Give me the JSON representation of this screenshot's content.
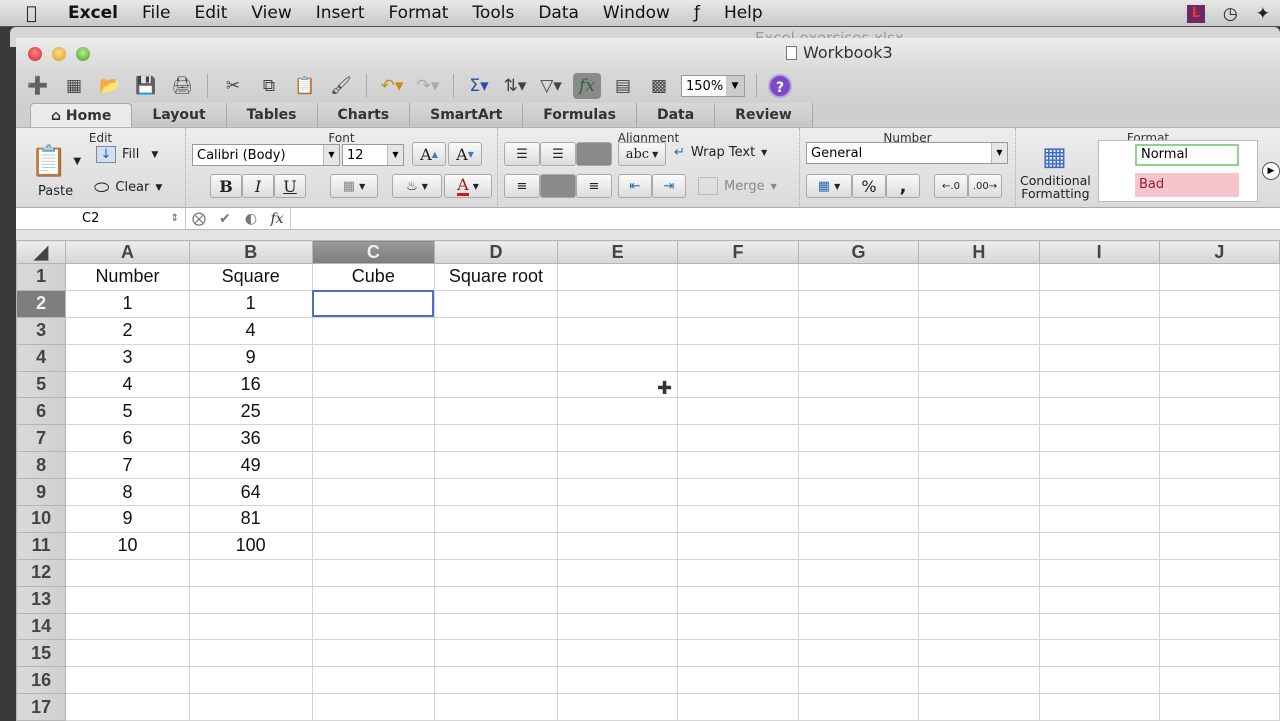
{
  "menubar": {
    "apple_icon": "apple-icon",
    "items": [
      "Excel",
      "File",
      "Edit",
      "View",
      "Insert",
      "Format",
      "Tools",
      "Data",
      "Window",
      "Help"
    ],
    "status_letter": "L"
  },
  "background_window": {
    "title": "Excel exercises.xlsx"
  },
  "window": {
    "title": "Workbook3"
  },
  "toolbar": {
    "zoom": "150%",
    "fx_label": "fx",
    "help_label": "?"
  },
  "tabs": [
    {
      "label": "Home",
      "active": true
    },
    {
      "label": "Layout"
    },
    {
      "label": "Tables"
    },
    {
      "label": "Charts"
    },
    {
      "label": "SmartArt"
    },
    {
      "label": "Formulas"
    },
    {
      "label": "Data"
    },
    {
      "label": "Review"
    }
  ],
  "ribbon": {
    "edit": {
      "label": "Edit",
      "paste": "Paste",
      "fill": "Fill",
      "clear": "Clear"
    },
    "font": {
      "label": "Font",
      "family": "Calibri (Body)",
      "size": "12",
      "bold": "B",
      "italic": "I",
      "underline": "U",
      "grow": "A",
      "shrink": "A",
      "color_letter": "A"
    },
    "alignment": {
      "label": "Alignment",
      "abc": "abc",
      "wrap": "Wrap Text",
      "merge": "Merge"
    },
    "number": {
      "label": "Number",
      "format": "General",
      "percent": "%",
      "comma": ","
    },
    "format": {
      "label": "Format",
      "cond_1": "Conditional",
      "cond_2": "Formatting",
      "style_normal": "Normal",
      "style_bad": "Bad"
    }
  },
  "formula_bar": {
    "name_box": "C2",
    "fx": "fx",
    "value": ""
  },
  "sheet": {
    "columns": [
      "A",
      "B",
      "C",
      "D",
      "E",
      "F",
      "G",
      "H",
      "I",
      "J"
    ],
    "selected_cell": "C2",
    "rows": [
      {
        "n": "1",
        "cells": [
          "Number",
          "Square",
          "Cube",
          "Square root",
          "",
          "",
          "",
          "",
          "",
          ""
        ]
      },
      {
        "n": "2",
        "cells": [
          "1",
          "1",
          "",
          "",
          "",
          "",
          "",
          "",
          "",
          ""
        ]
      },
      {
        "n": "3",
        "cells": [
          "2",
          "4",
          "",
          "",
          "",
          "",
          "",
          "",
          "",
          ""
        ]
      },
      {
        "n": "4",
        "cells": [
          "3",
          "9",
          "",
          "",
          "",
          "",
          "",
          "",
          "",
          ""
        ]
      },
      {
        "n": "5",
        "cells": [
          "4",
          "16",
          "",
          "",
          "",
          "",
          "",
          "",
          "",
          ""
        ]
      },
      {
        "n": "6",
        "cells": [
          "5",
          "25",
          "",
          "",
          "",
          "",
          "",
          "",
          "",
          ""
        ]
      },
      {
        "n": "7",
        "cells": [
          "6",
          "36",
          "",
          "",
          "",
          "",
          "",
          "",
          "",
          ""
        ]
      },
      {
        "n": "8",
        "cells": [
          "7",
          "49",
          "",
          "",
          "",
          "",
          "",
          "",
          "",
          ""
        ]
      },
      {
        "n": "9",
        "cells": [
          "8",
          "64",
          "",
          "",
          "",
          "",
          "",
          "",
          "",
          ""
        ]
      },
      {
        "n": "10",
        "cells": [
          "9",
          "81",
          "",
          "",
          "",
          "",
          "",
          "",
          "",
          ""
        ]
      },
      {
        "n": "11",
        "cells": [
          "10",
          "100",
          "",
          "",
          "",
          "",
          "",
          "",
          "",
          ""
        ]
      },
      {
        "n": "12",
        "cells": [
          "",
          "",
          "",
          "",
          "",
          "",
          "",
          "",
          "",
          ""
        ]
      },
      {
        "n": "13",
        "cells": [
          "",
          "",
          "",
          "",
          "",
          "",
          "",
          "",
          "",
          ""
        ]
      },
      {
        "n": "14",
        "cells": [
          "",
          "",
          "",
          "",
          "",
          "",
          "",
          "",
          "",
          ""
        ]
      },
      {
        "n": "15",
        "cells": [
          "",
          "",
          "",
          "",
          "",
          "",
          "",
          "",
          "",
          ""
        ]
      },
      {
        "n": "16",
        "cells": [
          "",
          "",
          "",
          "",
          "",
          "",
          "",
          "",
          "",
          ""
        ]
      },
      {
        "n": "17",
        "cells": [
          "",
          "",
          "",
          "",
          "",
          "",
          "",
          "",
          "",
          ""
        ]
      }
    ]
  }
}
